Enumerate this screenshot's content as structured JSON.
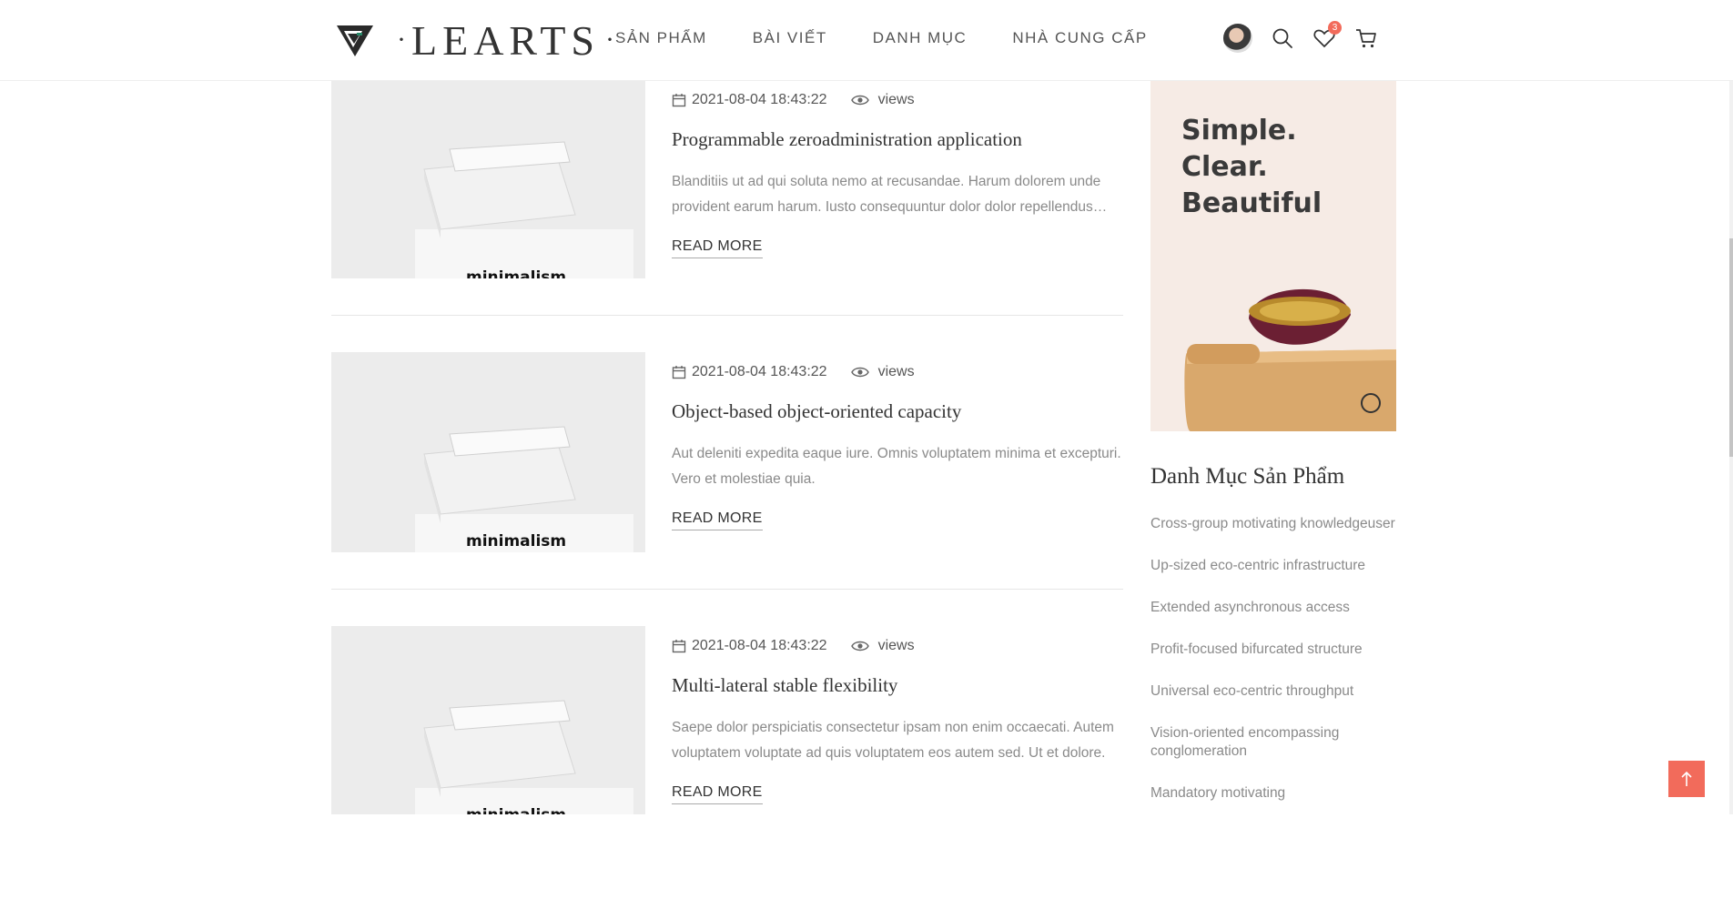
{
  "header": {
    "logo_text": "LEARTS",
    "logo_dots": "·",
    "nav": [
      {
        "label": "SẢN PHẨM"
      },
      {
        "label": "BÀI VIẾT"
      },
      {
        "label": "DANH MỤC"
      },
      {
        "label": "NHÀ CUNG CẤP"
      }
    ],
    "wishlist_count": "3"
  },
  "posts": [
    {
      "date": "2021-08-04 18:43:22",
      "views_label": "views",
      "title": "Programmable zeroadministration application",
      "excerpt": "Blanditiis ut ad qui soluta nemo at recusandae. Harum dolorem unde provident earum harum. Iusto consequuntur dolor dolor repellendus voluptatem.",
      "read_more": "READ MORE",
      "thumb_text": "minimalism"
    },
    {
      "date": "2021-08-04 18:43:22",
      "views_label": "views",
      "title": "Object-based object-oriented capacity",
      "excerpt": "Aut deleniti expedita eaque iure. Omnis voluptatem minima et excepturi. Vero et molestiae quia.",
      "read_more": "READ MORE",
      "thumb_text": "minimalism"
    },
    {
      "date": "2021-08-04 18:43:22",
      "views_label": "views",
      "title": "Multi-lateral stable flexibility",
      "excerpt": "Saepe dolor perspiciatis consectetur ipsam non enim occaecati. Autem voluptatem voluptate ad quis voluptatem eos autem sed. Ut et dolore.",
      "read_more": "READ MORE",
      "thumb_text": "minimalism"
    }
  ],
  "sidebar": {
    "banner_text": "Simple.\nClear.\nBeautiful",
    "categories_title": "Danh Mục Sản Phẩm",
    "categories": [
      "Cross-group motivating knowledgeuser",
      "Up-sized eco-centric infrastructure",
      "Extended asynchronous access",
      "Profit-focused bifurcated structure",
      "Universal eco-centric throughput",
      "Vision-oriented encompassing conglomeration",
      "Mandatory motivating"
    ]
  },
  "colors": {
    "accent": "#f26b5b",
    "banner_bg": "#f6ebe5",
    "muted_text": "#8a8a8a"
  },
  "icons": {
    "calendar": "calendar-icon",
    "views": "eye-icon",
    "search": "search-icon",
    "wishlist": "heart-icon",
    "cart": "cart-icon",
    "back_to_top": "arrow-up-icon"
  }
}
